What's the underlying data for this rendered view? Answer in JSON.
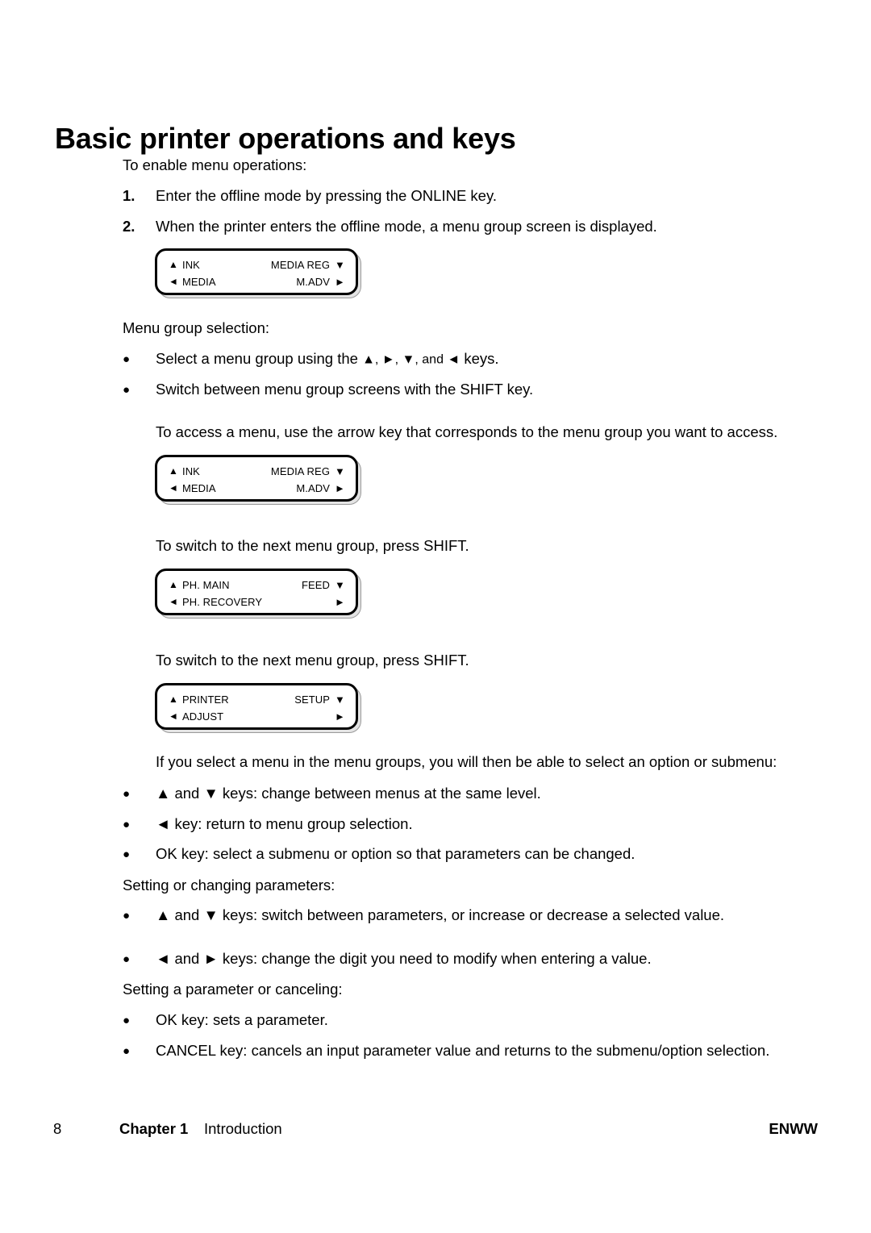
{
  "heading": "Basic printer operations and keys",
  "intro": {
    "lead": "To enable menu operations:",
    "steps": [
      {
        "marker": "1.",
        "text": "Enter the offline mode by pressing the ONLINE key."
      },
      {
        "marker": "2.",
        "text": "When the printer enters the offline mode, a menu group screen is displayed."
      }
    ]
  },
  "menu_group_selection": {
    "lead": "Menu group selection:",
    "bullets": [
      {
        "prefix": "Select a menu group using the ",
        "arrows": "▲, ►, ▼, and ◄",
        "suffix": " keys."
      },
      {
        "text": "Switch between menu group screens with the SHIFT key."
      }
    ],
    "access_note": "To access a menu, use the arrow key that corresponds to the menu group you want to access.",
    "shift_note_1": "To switch to the next menu group, press SHIFT.",
    "shift_note_2": "To switch to the next menu group, press SHIFT."
  },
  "lcd_panels": [
    {
      "id": "menu-group-screen-1",
      "top_left_glyph": "▲",
      "top_left_label": "INK",
      "top_right_label": "MEDIA REG",
      "top_right_glyph": "▼",
      "bottom_left_glyph": "◄",
      "bottom_left_label": "MEDIA",
      "bottom_right_label": "M.ADV",
      "bottom_right_glyph": "►"
    },
    {
      "id": "menu-group-screen-2",
      "top_left_glyph": "▲",
      "top_left_label": "INK",
      "top_right_label": "MEDIA REG",
      "top_right_glyph": "▼",
      "bottom_left_glyph": "◄",
      "bottom_left_label": "MEDIA",
      "bottom_right_label": "M.ADV",
      "bottom_right_glyph": "►"
    },
    {
      "id": "menu-group-screen-3",
      "top_left_glyph": "▲",
      "top_left_label": "PH. MAIN",
      "top_right_label": "FEED",
      "top_right_glyph": "▼",
      "bottom_left_glyph": "◄",
      "bottom_left_label": "PH. RECOVERY",
      "bottom_right_label": "",
      "bottom_right_glyph": "►"
    },
    {
      "id": "menu-group-screen-4",
      "top_left_glyph": "▲",
      "top_left_label": "PRINTER",
      "top_right_label": "SETUP",
      "top_right_glyph": "▼",
      "bottom_left_glyph": "◄",
      "bottom_left_label": "ADJUST",
      "bottom_right_label": "",
      "bottom_right_glyph": "►"
    }
  ],
  "submenu_section": {
    "lead": "If you select a menu in the menu groups, you will then be able to select an option or submenu:",
    "bullets": [
      {
        "text": "▲ and ▼ keys: change between menus at the same level."
      },
      {
        "text": "◄ key: return to menu group selection."
      },
      {
        "text": "OK key: select a submenu or option so that parameters can be changed."
      }
    ]
  },
  "parameters_section": {
    "lead": "Setting or changing parameters:",
    "bullets": [
      {
        "text": "▲ and ▼ keys: switch between parameters, or increase or decrease a selected value."
      },
      {
        "text": "◄ and ► keys: change the digit you need to modify when entering a value."
      }
    ]
  },
  "cancel_section": {
    "lead": "Setting a parameter or canceling:",
    "bullets": [
      {
        "text": "OK key: sets a parameter."
      },
      {
        "text": "CANCEL key: cancels an input parameter value and returns to the submenu/option selection."
      }
    ]
  },
  "footer": {
    "page_number": "8",
    "chapter": "Chapter 1",
    "chapter_title": "Introduction",
    "brand": "ENWW"
  },
  "bullet_glyph": "●"
}
